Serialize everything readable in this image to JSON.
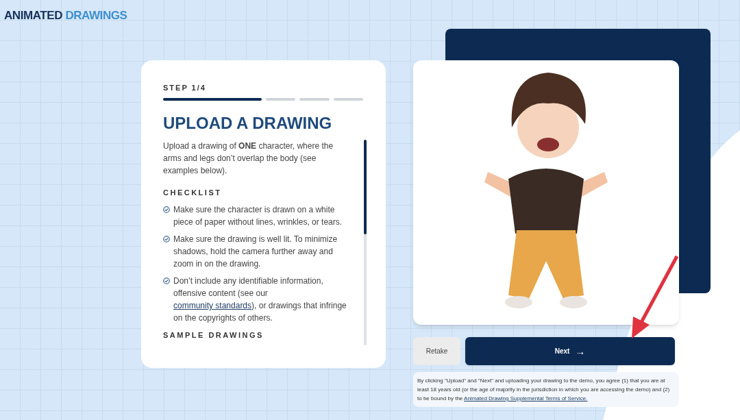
{
  "logo": {
    "dark": "ANIMATED",
    "light": "DRAWINGS"
  },
  "step": {
    "label": "STEP 1/4",
    "segments": [
      {
        "active": true
      },
      {
        "active": false
      },
      {
        "active": false
      },
      {
        "active": false
      }
    ]
  },
  "title": "UPLOAD A DRAWING",
  "intro": "Upload a drawing of **ONE** character, where the arms and legs don’t overlap the body (see examples below).",
  "checklist": {
    "heading": "CHECKLIST",
    "items": [
      {
        "parts": [
          {
            "text": "Make sure the character is drawn on a white piece of paper without lines, wrinkles, or tears."
          }
        ]
      },
      {
        "parts": [
          {
            "text": "Make sure the drawing is well lit. To minimize shadows, hold the camera further away and zoom in on the drawing."
          }
        ]
      },
      {
        "parts": [
          {
            "text": "Don’t include any identifiable information, offensive content (see our "
          },
          {
            "text": "community standards",
            "link": true
          },
          {
            "text": "), or drawings that infringe on the copyrights of others."
          }
        ]
      }
    ]
  },
  "samples_heading": "SAMPLE DRAWINGS",
  "buttons": [
    {
      "label": "Retake",
      "kind": "secondary"
    },
    {
      "label": "Next",
      "kind": "primary",
      "icon": "→"
    }
  ],
  "terms": [
    {
      "text": "By clicking \"Upload\" and \"Next\" and uploading your drawing to the demo, you agree (1) that you are at least 18 years old (or the age of majority in the jurisdiction in which you are accessing the demo) and (2) to be bound by the "
    },
    {
      "text": "Animated Drawing Supplemental Terms of Service.",
      "link": true
    }
  ]
}
